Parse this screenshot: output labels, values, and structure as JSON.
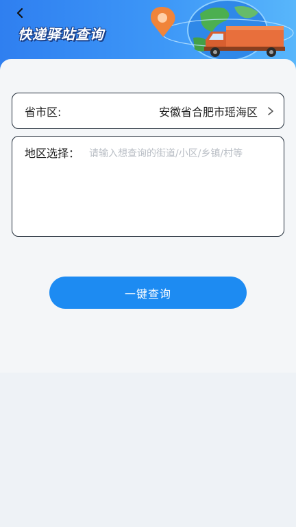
{
  "header": {
    "title": "快递驿站查询",
    "back_icon": "chevron-left-icon",
    "colors": {
      "gradient_start": "#2f7ff0",
      "gradient_end": "#58b6fb"
    }
  },
  "form": {
    "region": {
      "label": "省市区:",
      "value": "安徽省合肥市瑶海区",
      "icon": "chevron-right-icon"
    },
    "area": {
      "label": "地区选择：",
      "placeholder": "请输入想查询的街道/小区/乡镇/村等",
      "value": ""
    }
  },
  "actions": {
    "query_label": "一键查询",
    "color": "#1d8bf2"
  }
}
